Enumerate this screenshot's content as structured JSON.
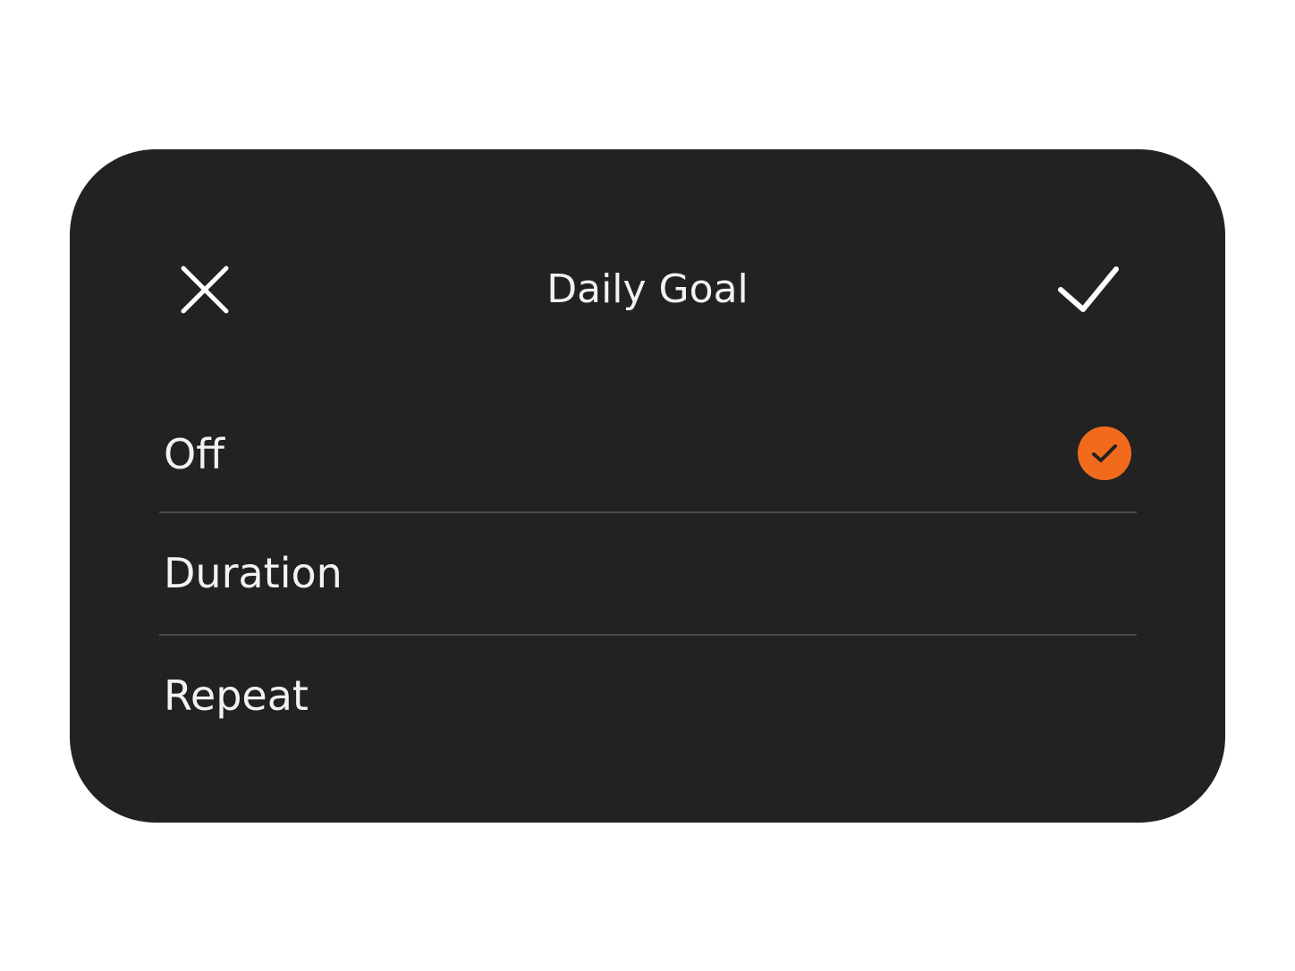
{
  "dialog": {
    "title": "Daily Goal",
    "close_icon": "close-icon",
    "confirm_icon": "checkmark-icon"
  },
  "options": [
    {
      "label": "Off",
      "selected": true
    },
    {
      "label": "Duration",
      "selected": false
    },
    {
      "label": "Repeat",
      "selected": false
    }
  ],
  "colors": {
    "background": "#ffffff",
    "dialog_bg": "#222222",
    "text": "#f2f2f2",
    "divider": "#4a4a4a",
    "accent": "#f26b1d",
    "check_mark": "#222222"
  }
}
